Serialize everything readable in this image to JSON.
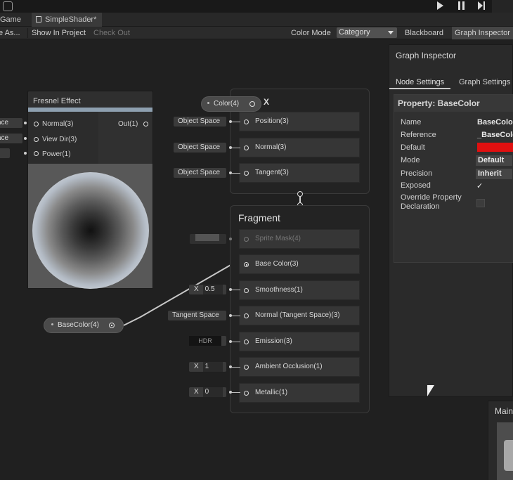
{
  "window": {
    "controls": {
      "play_icon": "play",
      "pause_icon": "pause",
      "step_icon": "step"
    }
  },
  "tabs": [
    {
      "label": "Game"
    },
    {
      "label": "SimpleShader*"
    }
  ],
  "toolbar": {
    "save_as": "e As...",
    "show_in_project": "Show In Project",
    "check_out": "Check Out",
    "color_mode_label": "Color Mode",
    "color_mode_value": "Category",
    "blackboard": "Blackboard",
    "graph_inspector": "Graph Inspector"
  },
  "fresnel_node": {
    "title": "Fresnel Effect",
    "inputs": [
      {
        "label": "Normal(3)",
        "value": "ace"
      },
      {
        "label": "View Dir(3)",
        "value": "ace"
      },
      {
        "label": "Power(1)",
        "value": ""
      }
    ],
    "output": "Out(1)"
  },
  "vertex_stack": {
    "color_pill": "Color(4)",
    "partial_title": "X",
    "blocks": [
      {
        "label": "Position(3)",
        "input": "Object Space"
      },
      {
        "label": "Normal(3)",
        "input": "Object Space"
      },
      {
        "label": "Tangent(3)",
        "input": "Object Space"
      }
    ]
  },
  "fragment_stack": {
    "title": "Fragment",
    "blocks": [
      {
        "label": "Sprite Mask(4)",
        "input": "",
        "dim": true
      },
      {
        "label": "Base Color(3)",
        "input": ""
      },
      {
        "label": "Smoothness(1)",
        "input_prefix": "X",
        "input": "0.5"
      },
      {
        "label": "Normal (Tangent Space)(3)",
        "input": "Tangent Space"
      },
      {
        "label": "Emission(3)",
        "input": "HDR"
      },
      {
        "label": "Ambient Occlusion(1)",
        "input_prefix": "X",
        "input": "1"
      },
      {
        "label": "Metallic(1)",
        "input_prefix": "X",
        "input": "0"
      }
    ]
  },
  "basecolor_pill": "BaseColor(4)",
  "inspector": {
    "title": "Graph Inspector",
    "tabs": [
      "Node Settings",
      "Graph Settings"
    ],
    "section": "Property: BaseColor",
    "rows": [
      {
        "label": "Name",
        "value": "BaseColo"
      },
      {
        "label": "Reference",
        "value": "_BaseColo"
      },
      {
        "label": "Default",
        "value": ""
      },
      {
        "label": "Mode",
        "value": "Default"
      },
      {
        "label": "Precision",
        "value": "Inherit"
      },
      {
        "label": "Exposed",
        "value": "✓"
      },
      {
        "label": "Override Property Declaration",
        "value": ""
      }
    ],
    "default_color": "#e01010"
  },
  "main_preview": {
    "label": "Main"
  }
}
